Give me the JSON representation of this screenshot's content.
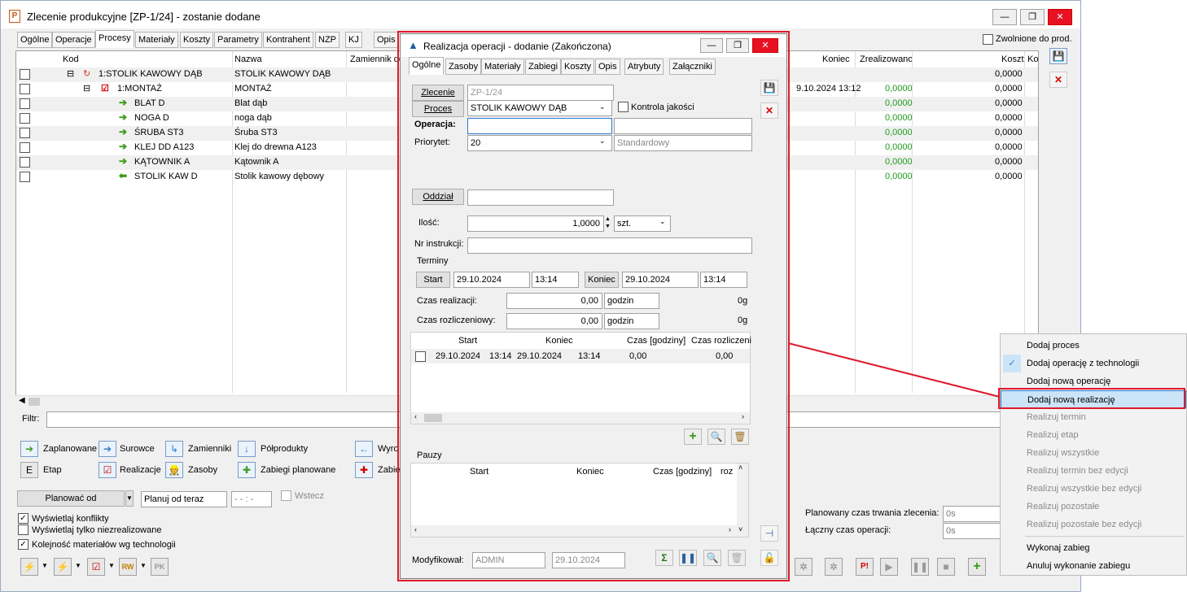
{
  "window": {
    "title": "Zlecenie produkcyjne  [ZP-1/24] - zostanie dodane"
  },
  "tabs": [
    "Ogólne",
    "Operacje",
    "Procesy",
    "Materiały",
    "Koszty",
    "Parametry",
    "Kontrahent",
    "NZP",
    "KJ",
    "Opis"
  ],
  "released_label": "Zwolnione do prod.",
  "grid": {
    "headers": {
      "kod": "Kod",
      "nazwa": "Nazwa",
      "zamiennik": "Zamiennik do",
      "koniec": "Koniec",
      "zrealizowano": "Zrealizowano",
      "koszt": "Koszt",
      "ko": "Ko"
    },
    "rows": [
      {
        "kod": "1:STOLIK KAWOWY DĄB",
        "nazwa": "STOLIK KAWOWY DĄB",
        "koniec": "",
        "zreal": "",
        "koszt": "0,0000"
      },
      {
        "kod": "1:MONTAŻ",
        "nazwa": "MONTAŻ",
        "koniec": "9.10.2024 13:12",
        "zreal": "0,0000",
        "koszt": "0,0000"
      },
      {
        "kod": "BLAT D",
        "nazwa": "Blat dąb",
        "koniec": "",
        "zreal": "0,0000",
        "koszt": "0,0000"
      },
      {
        "kod": "NOGA D",
        "nazwa": "noga dąb",
        "koniec": "",
        "zreal": "0,0000",
        "koszt": "0,0000"
      },
      {
        "kod": "ŚRUBA ST3",
        "nazwa": "Śruba ST3",
        "koniec": "",
        "zreal": "0,0000",
        "koszt": "0,0000"
      },
      {
        "kod": "KLEJ DD A123",
        "nazwa": "Klej do drewna A123",
        "koniec": "",
        "zreal": "0,0000",
        "koszt": "0,0000"
      },
      {
        "kod": "KĄTOWNIK A",
        "nazwa": "Kątownik A",
        "koniec": "",
        "zreal": "0,0000",
        "koszt": "0,0000"
      },
      {
        "kod": "STOLIK KAW D",
        "nazwa": "Stolik kawowy dębowy",
        "koniec": "",
        "zreal": "0,0000",
        "koszt": "0,0000"
      }
    ]
  },
  "filter_label": "Filtr:",
  "legend": {
    "zaplanowane": "Zaplanowane",
    "surowce": "Surowce",
    "zamienniki": "Zamienniki",
    "polprodukty": "Półprodukty",
    "wyro": "Wyro",
    "etap": "Etap",
    "realizacje": "Realizacje",
    "zasoby": "Zasoby",
    "zabiegi": "Zabiegi planowane",
    "zabie": "Zabie"
  },
  "planning": {
    "mode": "Planować od",
    "from": "Planuj od teraz",
    "time": "- - : -",
    "wstecz": "Wstecz"
  },
  "options": {
    "konflikty": "Wyświetlaj konflikty",
    "niezreal": "Wyświetlaj tylko niezrealizowane",
    "kolejnosc": "Kolejność materiałów wg technologii"
  },
  "summary": {
    "plan_label": "Planowany czas trwania zlecenia:",
    "plan_value": "0s",
    "total_label": "Łączny czas operacji:",
    "total_value": "0s"
  },
  "dialog": {
    "title": "Realizacja operacji - dodanie (Zakończona)",
    "tabs": [
      "Ogólne",
      "Zasoby",
      "Materiały",
      "Zabiegi",
      "Koszty",
      "Opis",
      "Atrybuty",
      "Załączniki"
    ],
    "zlecenie_btn": "Zlecenie",
    "zlecenie_val": "ZP-1/24",
    "proces_btn": "Proces",
    "proces_val": "STOLIK KAWOWY DĄB",
    "kontrola": "Kontrola jakości",
    "operacja_lbl": "Operacja:",
    "priorytet_lbl": "Priorytet:",
    "priorytet_val": "20",
    "priorytet_desc": "Standardowy",
    "oddzial_btn": "Oddział",
    "ilosc_lbl": "Ilość:",
    "ilosc_val": "1,0000",
    "jm": "szt.",
    "nr_lbl": "Nr instrukcji:",
    "terminy": "Terminy",
    "start_btn": "Start",
    "start_date": "29.10.2024",
    "start_time": "13:14",
    "koniec_btn": "Koniec",
    "end_date": "29.10.2024",
    "end_time": "13:14",
    "czas_real_lbl": "Czas realizacji:",
    "czas_real_val": "0,00",
    "czas_real_unit": "godzin",
    "czas_real_right": "0g",
    "czas_roz_lbl": "Czas rozliczeniowy:",
    "czas_roz_val": "0,00",
    "czas_roz_unit": "godzin",
    "czas_roz_right": "0g",
    "real_grid": {
      "h_start": "Start",
      "h_koniec": "Koniec",
      "h_czas": "Czas [godziny]",
      "h_roz": "Czas rozliczeni",
      "row": {
        "start_d": "29.10.2024",
        "start_t": "13:14",
        "end_d": "29.10.2024",
        "end_t": "13:14",
        "czas": "0,00",
        "roz": "0,00"
      }
    },
    "pauzy": "Pauzy",
    "pauzy_grid": {
      "h_start": "Start",
      "h_koniec": "Koniec",
      "h_czas": "Czas [godziny]",
      "h_roz": "roz"
    },
    "mod_lbl": "Modyfikował:",
    "mod_user": "ADMIN",
    "mod_date": "29.10.2024"
  },
  "menu": {
    "items": [
      {
        "label": "Dodaj proces",
        "state": "normal"
      },
      {
        "label": "Dodaj operację z technologii",
        "state": "checked"
      },
      {
        "label": "Dodaj nową operację",
        "state": "normal"
      },
      {
        "label": "Dodaj nową realizację",
        "state": "highlight"
      },
      {
        "label": "Realizuj termin",
        "state": "disabled"
      },
      {
        "label": "Realizuj etap",
        "state": "disabled"
      },
      {
        "label": "Realizuj wszystkie",
        "state": "disabled"
      },
      {
        "label": "Realizuj termin bez edycji",
        "state": "disabled"
      },
      {
        "label": "Realizuj wszystkie bez edycji",
        "state": "disabled"
      },
      {
        "label": "Realizuj pozostałe",
        "state": "disabled"
      },
      {
        "label": "Realizuj pozostałe bez edycji",
        "state": "disabled"
      },
      {
        "label": "Wykonaj zabieg",
        "state": "normal"
      },
      {
        "label": "Anuluj wykonanie zabiegu",
        "state": "normal"
      }
    ]
  },
  "colors": {
    "accent": "#2b7bd0",
    "highlight_border": "#e0182b",
    "green": "#1f9a1f"
  }
}
